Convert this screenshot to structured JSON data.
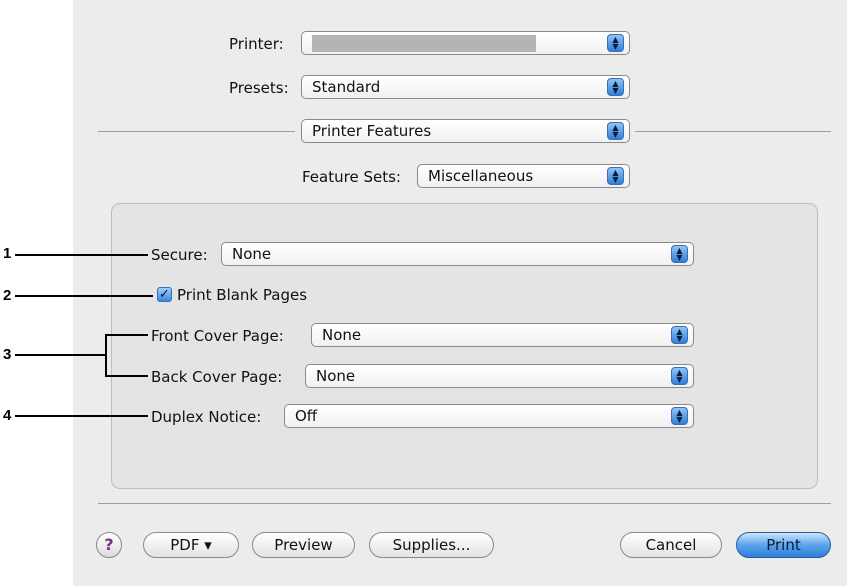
{
  "printer": {
    "label": "Printer:",
    "value": ""
  },
  "presets": {
    "label": "Presets:",
    "value": "Standard"
  },
  "pane_selector": {
    "value": "Printer Features"
  },
  "feature_sets": {
    "label": "Feature Sets:",
    "value": "Miscellaneous"
  },
  "options": {
    "secure": {
      "label": "Secure:",
      "value": "None"
    },
    "print_blank_pages": {
      "label": "Print Blank Pages",
      "checked": true
    },
    "front_cover_page": {
      "label": "Front Cover Page:",
      "value": "None"
    },
    "back_cover_page": {
      "label": "Back Cover Page:",
      "value": "None"
    },
    "duplex_notice": {
      "label": "Duplex Notice:",
      "value": "Off"
    }
  },
  "callouts": [
    "1",
    "2",
    "3",
    "4"
  ],
  "buttons": {
    "help": "?",
    "pdf": "PDF ▾",
    "preview": "Preview",
    "supplies": "Supplies...",
    "cancel": "Cancel",
    "print": "Print"
  },
  "icons": {
    "popup_arrows": "updown-arrows-icon",
    "checkmark": "checkmark-icon"
  },
  "colors": {
    "accent": "#3d87dc",
    "dialog_bg": "#ececec"
  }
}
